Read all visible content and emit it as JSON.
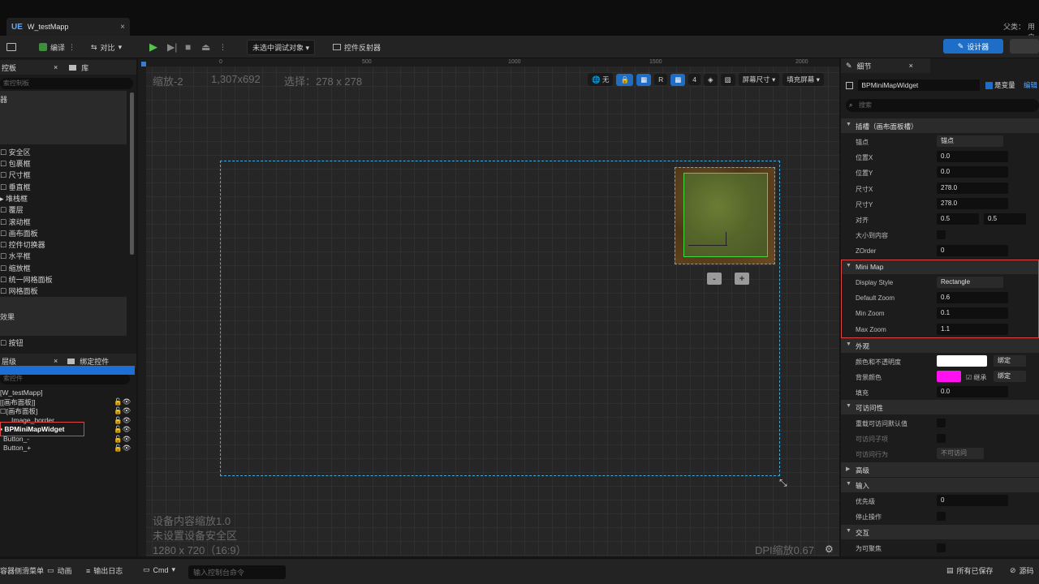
{
  "tabbar": {
    "doc_tab": "W_testMapp",
    "doc_icon": "UE",
    "close": "×",
    "right_text_1": "父类：",
    "right_text_2": "用户"
  },
  "toolbar": {
    "compile": "编译",
    "diff": "对比",
    "debug_target": "未选中调试对象",
    "widget_reflector": "控件反射器",
    "designer": "设计器"
  },
  "left": {
    "palette_tab": "控板",
    "library_tab": "库",
    "search_placeholder": "索控制板",
    "group1_label": "器",
    "palette_items": [
      "安全区",
      "包裹框",
      "尺寸框",
      "垂直框",
      "堆栈框",
      "覆层",
      "滚动框",
      "画布面板",
      "控件切换器",
      "水平框",
      "缩放框",
      "统一网格面板",
      "网格面板"
    ],
    "group2_label": "效果",
    "button_item": "按钮",
    "hierarchy_tab": "层级",
    "bind_tab": "绑定控件",
    "hier_search": "索控件",
    "hierarchy": [
      "[W_testMapp]",
      "[画布面板]",
      "[画布面板]",
      "Image_border",
      "BPMiniMapWidget",
      "Button_-",
      "Button_+"
    ]
  },
  "viewport": {
    "zoom": "缩放-2",
    "resolution": "1,307x692",
    "selection": "选择：278 x 278",
    "rulers": [
      "0",
      "500",
      "1000",
      "1500",
      "2000"
    ],
    "none_label": "无",
    "r_label": "R",
    "grid_num": "4",
    "screen_size": "屏幕尺寸",
    "fill_screen": "填充屏幕",
    "minus": "-",
    "plus": "+",
    "device_scale": "设备内容缩放1.0",
    "safe_zone": "未设置设备安全区",
    "size_ratio": "1280 x 720（16:9）",
    "dpi": "DPI缩放0.67"
  },
  "details": {
    "tab": "细节",
    "name": "BPMiniMapWidget",
    "is_variable": "是变量",
    "edit": "编辑",
    "search": "搜索",
    "slot_section": "插槽（画布面板槽）",
    "anchor_label": "锚点",
    "anchor_value": "锚点",
    "pos_x_label": "位置X",
    "pos_x": "0.0",
    "pos_y_label": "位置Y",
    "pos_y": "0.0",
    "size_x_label": "尺寸X",
    "size_x": "278.0",
    "size_y_label": "尺寸Y",
    "size_y": "278.0",
    "align_label": "对齐",
    "align_x": "0.5",
    "align_y": "0.5",
    "size_to_content": "大小到内容",
    "zorder_label": "ZOrder",
    "zorder": "0",
    "minimap_section": "Mini Map",
    "display_style_label": "Display Style",
    "display_style": "Rectangle",
    "default_zoom_label": "Default Zoom",
    "default_zoom": "0.6",
    "min_zoom_label": "Min Zoom",
    "min_zoom": "0.1",
    "max_zoom_label": "Max Zoom",
    "max_zoom": "1.1",
    "appearance_section": "外观",
    "color_opacity_label": "颜色和不透明度",
    "bind": "绑定",
    "bg_color_label": "背景颜色",
    "inherit": "继承",
    "padding_label": "填充",
    "padding": "0.0",
    "accessibility_section": "可访问性",
    "override_accessible": "重载可访问默认值",
    "accessible_children": "可访问子项",
    "accessible_behavior": "可访问行为",
    "not_accessible": "不可访问",
    "advanced_section": "高级",
    "input_section": "输入",
    "priority_label": "优先级",
    "priority": "0",
    "stop_action": "停止操作",
    "interaction_section": "交互",
    "focusable": "为可聚焦",
    "colors": {
      "white": "#ffffff",
      "magenta": "#ff10f0"
    }
  },
  "bottom": {
    "drawer": "容器侧滑菜单",
    "animation": "动画",
    "output_log": "输出日志",
    "cmd": "Cmd",
    "cmd_placeholder": "输入控制台命令",
    "all_saved": "所有已保存",
    "source": "源码"
  }
}
